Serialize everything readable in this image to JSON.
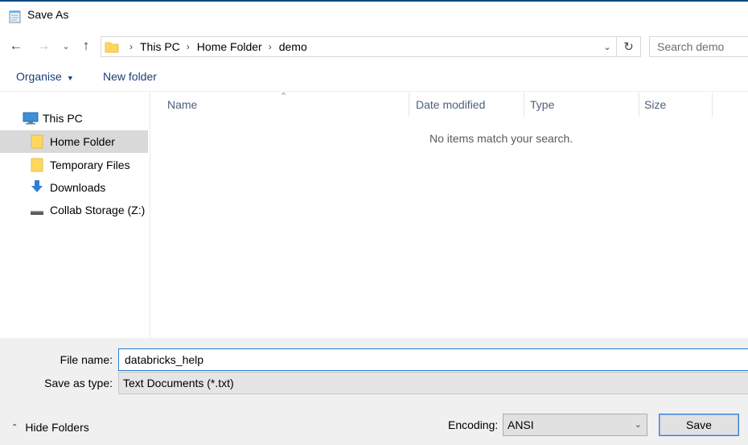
{
  "window": {
    "title": "Save As"
  },
  "address": {
    "crumbs": [
      "This PC",
      "Home Folder",
      "demo"
    ]
  },
  "search": {
    "placeholder": "Search demo"
  },
  "toolbar": {
    "organise_label": "Organise",
    "new_folder_label": "New folder"
  },
  "nav": {
    "items": [
      {
        "label": "This PC",
        "icon": "monitor-icon",
        "selected": false
      },
      {
        "label": "Home Folder",
        "icon": "folder-icon",
        "selected": true
      },
      {
        "label": "Temporary Files",
        "icon": "folder-icon",
        "selected": false
      },
      {
        "label": "Downloads",
        "icon": "download-arrow-icon",
        "selected": false
      },
      {
        "label": "Collab Storage (Z:)",
        "icon": "network-drive-icon",
        "selected": false
      }
    ]
  },
  "columns": {
    "name": "Name",
    "date_modified": "Date modified",
    "type": "Type",
    "size": "Size"
  },
  "content": {
    "empty_message": "No items match your search."
  },
  "form": {
    "file_name_label": "File name:",
    "file_name_value": "databricks_help",
    "save_type_label": "Save as type:",
    "save_type_value": "Text Documents (*.txt)",
    "encoding_label": "Encoding:",
    "encoding_value": "ANSI"
  },
  "footer": {
    "hide_folders_label": "Hide Folders",
    "save_label": "Save"
  },
  "colors": {
    "folder": "#ffd75e",
    "accent": "#2a7ad6",
    "link": "#1a3f7a",
    "download": "#2d7fd3",
    "monitor": "#3d8fd8"
  }
}
